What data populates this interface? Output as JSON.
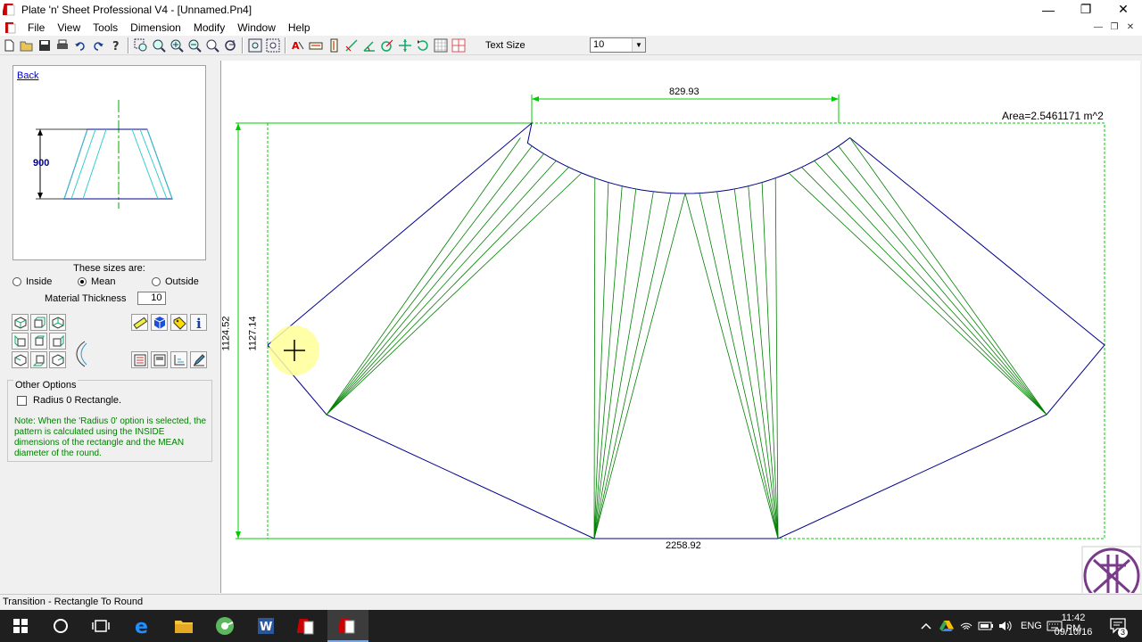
{
  "window": {
    "title": "Plate 'n' Sheet Professional V4 - [Unnamed.Pn4]",
    "minimize_glyph": "—",
    "maximize_glyph": "❐",
    "close_glyph": "✕"
  },
  "menu": {
    "items": [
      "File",
      "View",
      "Tools",
      "Dimension",
      "Modify",
      "Window",
      "Help"
    ]
  },
  "toolbar": {
    "text_size_label": "Text Size",
    "text_size_value": "10"
  },
  "left_panel": {
    "back_label": "Back",
    "preview_dimension": "900",
    "sizes_label": "These sizes are:",
    "radio_options": [
      {
        "label": "Inside",
        "selected": false
      },
      {
        "label": "Mean",
        "selected": true
      },
      {
        "label": "Outside",
        "selected": false
      }
    ],
    "material_thickness_label": "Material Thickness",
    "material_thickness_value": "10",
    "other_options_title": "Other Options",
    "radius_checkbox_label": "Radius 0 Rectangle.",
    "note_text": "Note:  When the 'Radius 0' option is selected, the pattern is calculated using the INSIDE dimensions of the rectangle and the MEAN diameter of the round."
  },
  "drawing": {
    "top_dimension": "829.93",
    "bottom_dimension": "2258.92",
    "left_dimension_outer": "1124.52",
    "left_dimension_inner": "1127.14",
    "area_label": "Area=2.5461171 m^2",
    "outline_color": "#00008b",
    "fold_line_color": "#008000",
    "dimension_color": "#00cc00",
    "cursor_highlight_color": "#ffff99"
  },
  "status": {
    "text": "Transition - Rectangle To Round"
  },
  "taskbar": {
    "language": "ENG",
    "time": "11:42 PM",
    "date": "09/10/16",
    "notification_count": "3"
  }
}
